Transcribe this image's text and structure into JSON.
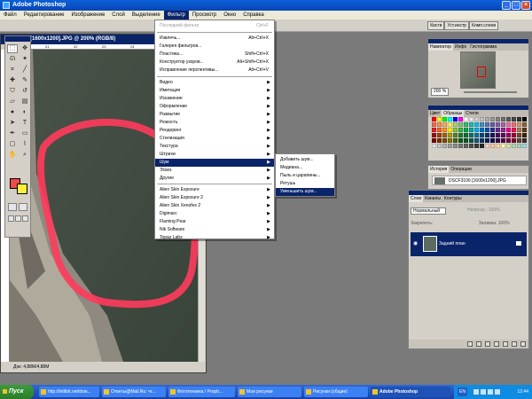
{
  "app": {
    "title": "Adobe Photoshop"
  },
  "menubar": [
    "Файл",
    "Редактирование",
    "Изображение",
    "Слой",
    "Выделение",
    "Фильтр",
    "Просмотр",
    "Окно",
    "Справка"
  ],
  "palette_well_tabs": [
    "Кисти",
    "Уст.инстр",
    "Комп.слоев"
  ],
  "document": {
    "title": "SCF3106 [1600x1200].JPG @ 200% (RGB/8)",
    "status": "Док: 4,88M/4,88M",
    "ruler_ticks": [
      "0",
      "21",
      "22",
      "23",
      "24",
      "25",
      "26"
    ]
  },
  "filter_menu": {
    "last_filter": {
      "label": "Последний фильтр",
      "shortcut": "Ctrl+F"
    },
    "group1": [
      {
        "label": "Извлечь...",
        "shortcut": "Alt+Ctrl+X"
      },
      {
        "label": "Галерея фильтров...",
        "shortcut": ""
      },
      {
        "label": "Пластика...",
        "shortcut": "Shift+Ctrl+X"
      },
      {
        "label": "Конструктор узоров...",
        "shortcut": "Alt+Shift+Ctrl+X"
      },
      {
        "label": "Исправление перспективы...",
        "shortcut": "Alt+Ctrl+V"
      }
    ],
    "group2": [
      "Видео",
      "Имитация",
      "Искажение",
      "Оформление",
      "Размытие",
      "Резкость",
      "Рендеринг",
      "Стилизация",
      "Текстура",
      "Штрихи",
      "Шум",
      "Эскиз",
      "Другие"
    ],
    "group3": [
      "Alien Skin Exposure",
      "Alien Skin Exposure 2",
      "Alien Skin Xenofex 2",
      "Digimarc",
      "Flaming Pear",
      "Nik Software",
      "Topaz Labs"
    ]
  },
  "noise_submenu": [
    "Добавить шум...",
    "Медиана...",
    "Пыль и царапины...",
    "Ретушь",
    "Уменьшить шум..."
  ],
  "navigator": {
    "tabs": [
      "Навигатор",
      "Инфо",
      "Гистограмма"
    ],
    "zoom": "200 %"
  },
  "swatches": {
    "tabs": [
      "Цвет",
      "Образцы",
      "Стили"
    ],
    "colors": [
      "#ff0000",
      "#ffff00",
      "#00ff00",
      "#00ffff",
      "#0000ff",
      "#ff00ff",
      "#ffffff",
      "#ebebeb",
      "#d6d6d6",
      "#c2c2c2",
      "#adadad",
      "#999999",
      "#858585",
      "#707070",
      "#5c5c5c",
      "#474747",
      "#333333",
      "#000000",
      "#f26c4f",
      "#f68e56",
      "#fbaf5d",
      "#fff568",
      "#acd372",
      "#7cc576",
      "#3bb878",
      "#1abbb4",
      "#00bff3",
      "#438ccb",
      "#5574b9",
      "#605ca8",
      "#855fa8",
      "#a763a8",
      "#f06ea9",
      "#f26d7d",
      "#c69c6d",
      "#8c6239",
      "#ed1c24",
      "#f26522",
      "#f7941d",
      "#fff200",
      "#8dc63f",
      "#39b54a",
      "#00a651",
      "#00a99d",
      "#00aeef",
      "#0072bc",
      "#0054a6",
      "#2e3192",
      "#662d91",
      "#92278f",
      "#ec008c",
      "#ed145b",
      "#a67c52",
      "#603913",
      "#9e0b0f",
      "#a0410d",
      "#a36209",
      "#aba000",
      "#598527",
      "#1a7b30",
      "#007236",
      "#00746b",
      "#0076a3",
      "#004b80",
      "#003471",
      "#1b1464",
      "#440e62",
      "#630460",
      "#9e005d",
      "#9e0039",
      "#754c24",
      "#42210b",
      "#790000",
      "#7b2e00",
      "#7d4900",
      "#827b00",
      "#406618",
      "#005e20",
      "#005826",
      "#005952",
      "#005b7f",
      "#003663",
      "#002157",
      "#0d004c",
      "#32004b",
      "#4b0049",
      "#7b0046",
      "#7a0026",
      "#534741",
      "#362f2d",
      "#e1e1e1",
      "#c8c8c8",
      "#b4b4b4",
      "#a0a0a0",
      "#8c8c8c",
      "#787878",
      "#646464",
      "#505050",
      "#3c3c3c",
      "#282828",
      "#f7d5c9",
      "#f9c9a8",
      "#fddbb0",
      "#fffbb5",
      "#d9e7b0",
      "#b6dbb0",
      "#a3d6c4",
      "#a5dbe2"
    ]
  },
  "history": {
    "tabs": [
      "История",
      "Операции"
    ],
    "item": "DSCF3106 [1600x1200].JPG"
  },
  "layers": {
    "tabs": [
      "Слои",
      "Каналы",
      "Контуры"
    ],
    "mode": "Нормальный",
    "opacity_label": "Непрозр.:",
    "opacity": "100%",
    "lock_label": "Закрепить:",
    "fill_label": "Заливка:",
    "fill": "100%",
    "layer_name": "Задний план"
  },
  "taskbar": {
    "start": "Пуск",
    "tasks": [
      "http://letitbit.net/dow...",
      "Ответы@Mail.Ru: чт...",
      "Фототехника / Proph...",
      "Мои рисунки",
      "Рисунки (общие)",
      "Adobe Photoshop"
    ],
    "lang": "EN",
    "clock": "12:44"
  },
  "tools": [
    "marquee-tool",
    "move-tool",
    "lasso-tool",
    "magic-wand-tool",
    "crop-tool",
    "slice-tool",
    "healing-tool",
    "brush-tool",
    "stamp-tool",
    "history-brush-tool",
    "eraser-tool",
    "gradient-tool",
    "blur-tool",
    "dodge-tool",
    "path-select-tool",
    "type-tool",
    "pen-tool",
    "shape-tool",
    "notes-tool",
    "eyedropper-tool",
    "hand-tool",
    "zoom-tool"
  ],
  "colors": {
    "foreground": "#f04a4a",
    "background": "#ffee3a",
    "accent": "#0a246a"
  }
}
